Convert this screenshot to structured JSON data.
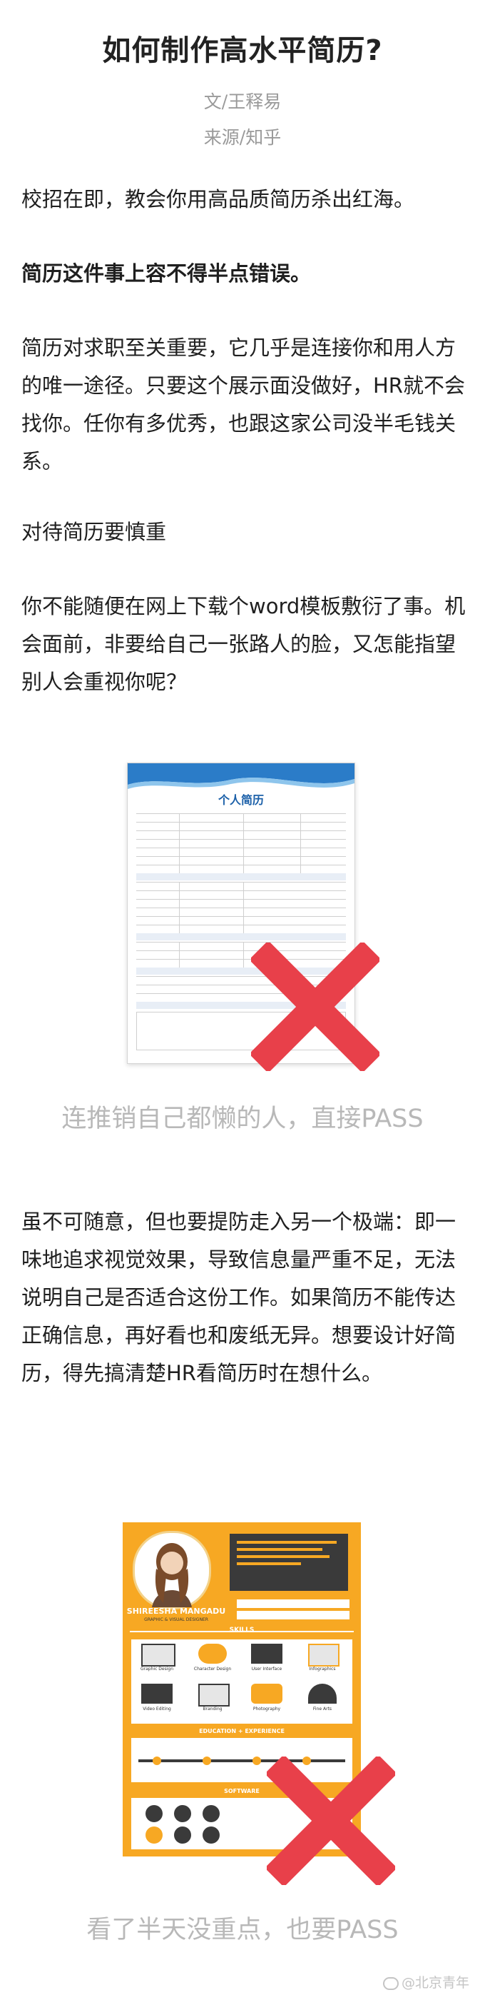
{
  "article": {
    "title": "如何制作高水平简历?",
    "author": "文/王释易",
    "source": "来源/知乎"
  },
  "paragraphs": [
    "校招在即，教会你用高品质简历杀出红海。",
    "简历这件事上容不得半点错误。",
    "简历对求职至关重要，它几乎是连接你和用人方的唯一途径。只要这个展示面没做好，HR就不会找你。任你有多优秀，也跟这家公司没半毛钱关系。",
    "对待简历要慎重",
    "你不能随便在网上下载个word模板敷衍了事。机会面前，非要给自己一张路人的脸，又怎能指望别人会重视你呢？",
    "虽不可随意，但也要提防走入另一个极端：即一味地追求视觉效果，导致信息量严重不足，无法说明自己是否适合这份工作。如果简历不能传达正确信息，再好看也和废纸无异。想要设计好简历，得先搞清楚HR看简历时在想什么。"
  ],
  "figure1": {
    "resume_title": "个人简历",
    "caption": "连推销自己都懒的人，直接PASS"
  },
  "figure2": {
    "name": "SHIREESHA MANGADU",
    "role": "GRAPHIC & VISUAL DESIGNER",
    "section_skills": "SKILLS",
    "section_education": "EDUCATION + EXPERIENCE",
    "section_software": "SOFTWARE",
    "skills": [
      "Graphic Design",
      "Character Design",
      "User Interface",
      "Infographics",
      "Video Editing",
      "Branding",
      "Photography",
      "Fine Arts"
    ],
    "caption": "看了半天没重点，也要PASS"
  },
  "watermark": "@北京青年",
  "colors": {
    "caption_gray": "#b8b8b8",
    "cross_red": "#e8404a",
    "resume_orange": "#f7a823",
    "resume_blue": "#1a5fa8"
  }
}
